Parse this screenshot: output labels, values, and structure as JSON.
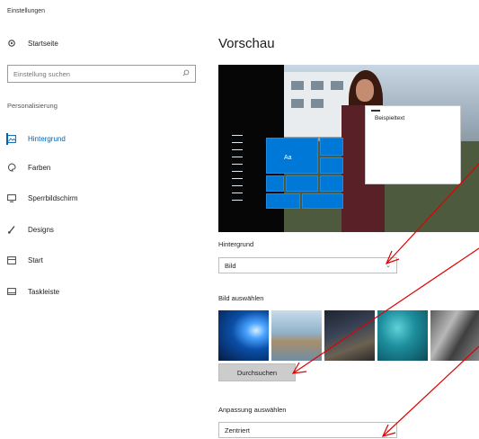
{
  "window": {
    "title": "Einstellungen"
  },
  "sidebar": {
    "home_label": "Startseite",
    "search": {
      "placeholder": "Einstellung suchen"
    },
    "section_label": "Personalisierung",
    "items": [
      {
        "label": "Hintergrund",
        "icon": "picture-icon",
        "active": true
      },
      {
        "label": "Farben",
        "icon": "palette-icon",
        "active": false
      },
      {
        "label": "Sperrbildschirm",
        "icon": "lockscreen-icon",
        "active": false
      },
      {
        "label": "Designs",
        "icon": "brush-icon",
        "active": false
      },
      {
        "label": "Start",
        "icon": "start-icon",
        "active": false
      },
      {
        "label": "Taskleiste",
        "icon": "taskbar-icon",
        "active": false
      }
    ]
  },
  "main": {
    "heading": "Vorschau",
    "preview": {
      "tile_text": "Aa",
      "sample_window_text": "Beispieltext"
    },
    "background": {
      "label": "Hintergrund",
      "value": "Bild"
    },
    "choose_picture": {
      "label": "Bild auswählen",
      "browse_label": "Durchsuchen"
    },
    "fit": {
      "label": "Anpassung auswählen",
      "value": "Zentriert"
    }
  },
  "colors": {
    "accent": "#0063b1",
    "tile_blue": "#0078d7",
    "annotation_arrow": "#e00000"
  }
}
